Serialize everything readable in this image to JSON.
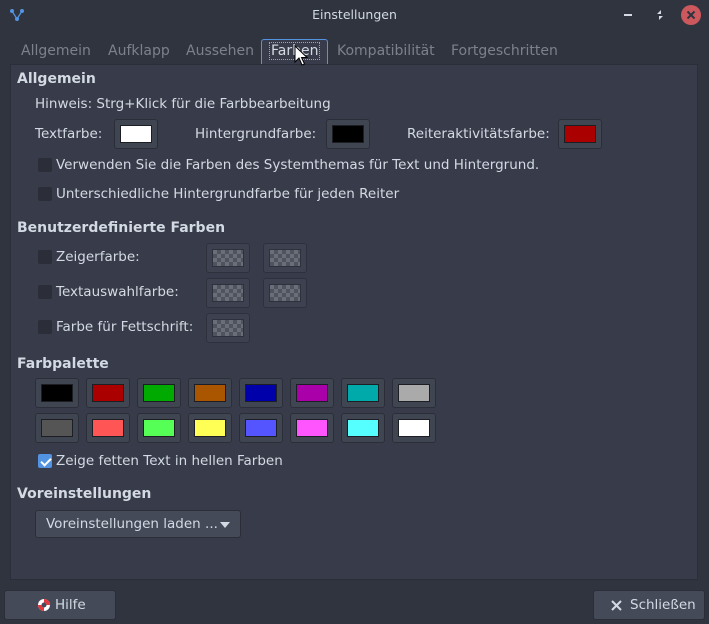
{
  "window": {
    "title": "Einstellungen",
    "icon": "terminal-app-icon"
  },
  "tabs": [
    {
      "label": "Allgemein",
      "active": false
    },
    {
      "label": "Aufklapp",
      "active": false
    },
    {
      "label": "Aussehen",
      "active": false
    },
    {
      "label": "Farben",
      "active": true
    },
    {
      "label": "Kompatibilität",
      "active": false
    },
    {
      "label": "Fortgeschritten",
      "active": false
    }
  ],
  "general": {
    "heading": "Allgemein",
    "hint": "Hinweis: Strg+Klick für die Farbbearbeitung",
    "text_color_label": "Textfarbe:",
    "text_color": "#ffffff",
    "bg_color_label": "Hintergrundfarbe:",
    "bg_color": "#000000",
    "tab_activity_label": "Reiteraktivitätsfarbe:",
    "tab_activity_color": "#aa0000",
    "use_system_colors_label": "Verwenden Sie die Farben des Systemthemas für Text und Hintergrund.",
    "use_system_colors_checked": false,
    "different_bg_label": "Unterschiedliche Hintergrundfarbe für jeden Reiter",
    "different_bg_checked": false
  },
  "custom": {
    "heading": "Benutzerdefinierte Farben",
    "cursor_label": "Zeigerfarbe:",
    "cursor_checked": false,
    "selection_label": "Textauswahlfarbe:",
    "selection_checked": false,
    "bold_label": "Farbe für Fettschrift:",
    "bold_checked": false
  },
  "palette": {
    "heading": "Farbpalette",
    "row1": [
      "#000000",
      "#aa0000",
      "#00aa00",
      "#aa5500",
      "#0000aa",
      "#aa00aa",
      "#00aaaa",
      "#aaaaaa"
    ],
    "row2": [
      "#555555",
      "#ff5555",
      "#55ff55",
      "#ffff55",
      "#5555ff",
      "#ff55ff",
      "#55ffff",
      "#ffffff"
    ],
    "bold_bright_label": "Zeige fetten Text in hellen Farben",
    "bold_bright_checked": true
  },
  "presets": {
    "heading": "Voreinstellungen",
    "dropdown_label": "Voreinstellungen laden ..."
  },
  "buttons": {
    "help_label": "Hilfe",
    "help_icon": "lifebuoy-icon",
    "close_label": "Schließen",
    "close_icon": "close-x-icon"
  }
}
